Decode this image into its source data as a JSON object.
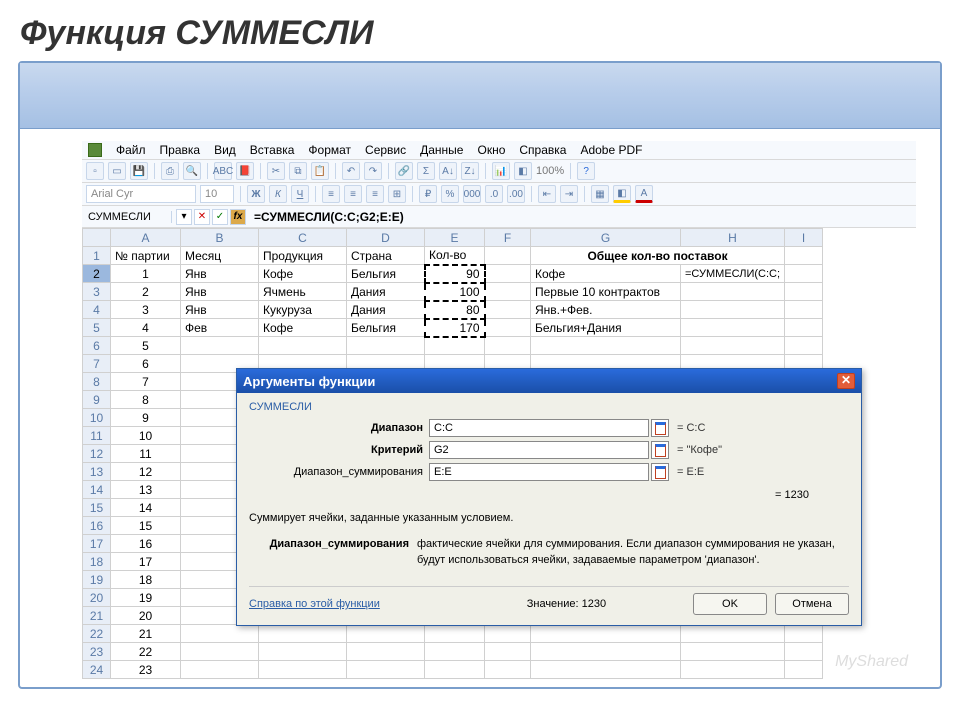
{
  "slide": {
    "title": "Функция СУММЕСЛИ"
  },
  "menu": {
    "items": [
      "Файл",
      "Правка",
      "Вид",
      "Вставка",
      "Формат",
      "Сервис",
      "Данные",
      "Окно",
      "Справка",
      "Adobe PDF"
    ]
  },
  "font": {
    "name": "Arial Cyr",
    "size": "10"
  },
  "toolbar": {
    "zoom": "100%",
    "bold": "Ж",
    "italic": "К",
    "underline": "Ч",
    "sum": "Σ",
    "abc": "ABC"
  },
  "formula_bar": {
    "name_box": "СУММЕСЛИ",
    "formula": "=СУММЕСЛИ(C:C;G2;E:E)"
  },
  "columns": [
    "A",
    "B",
    "C",
    "D",
    "E",
    "F",
    "G",
    "H",
    "I"
  ],
  "headers": {
    "a": "№ партии",
    "b": "Месяц",
    "c": "Продукция",
    "d": "Страна",
    "e": "Кол-во",
    "gh": "Общее кол-во поставок"
  },
  "rows": [
    {
      "n": "1",
      "a": "1",
      "b": "Янв",
      "c": "Кофе",
      "d": "Бельгия",
      "e": "90",
      "g": "Кофе",
      "h": "=СУММЕСЛИ(C:C;"
    },
    {
      "n": "2",
      "a": "2",
      "b": "Янв",
      "c": "Ячмень",
      "d": "Дания",
      "e": "100",
      "g": "Первые 10 контрактов",
      "h": ""
    },
    {
      "n": "3",
      "a": "3",
      "b": "Янв",
      "c": "Кукуруза",
      "d": "Дания",
      "e": "80",
      "g": "Янв.+Фев.",
      "h": ""
    },
    {
      "n": "4",
      "a": "4",
      "b": "Фев",
      "c": "Кофе",
      "d": "Бельгия",
      "e": "170",
      "g": "Бельгия+Дания",
      "h": ""
    }
  ],
  "row_numbers_tail": [
    "6",
    "7",
    "8",
    "9",
    "10",
    "11",
    "12",
    "13",
    "14",
    "15",
    "16",
    "17",
    "18",
    "19",
    "20",
    "21",
    "22",
    "23",
    "24"
  ],
  "a_tail": [
    "5",
    "6",
    "7",
    "8",
    "9",
    "10",
    "11",
    "12",
    "13",
    "14",
    "15",
    "16",
    "17",
    "18",
    "19",
    "20",
    "21",
    "22",
    "23"
  ],
  "dialog": {
    "title": "Аргументы функции",
    "func": "СУММЕСЛИ",
    "args": [
      {
        "label": "Диапазон",
        "bold": true,
        "value": "C:C",
        "eq": "= C:C"
      },
      {
        "label": "Критерий",
        "bold": true,
        "value": "G2",
        "eq": "= \"Кофе\""
      },
      {
        "label": "Диапазон_суммирования",
        "bold": false,
        "value": "E:E",
        "eq": "= E:E"
      }
    ],
    "result": "= 1230",
    "desc": "Суммирует ячейки, заданные указанным условием.",
    "param_name": "Диапазон_суммирования",
    "param_desc": "фактические ячейки для суммирования. Если диапазон суммирования не указан, будут использоваться ячейки, задаваемые параметром 'диапазон'.",
    "help": "Справка по этой функции",
    "value_label": "Значение:",
    "value": "1230",
    "ok": "OK",
    "cancel": "Отмена"
  },
  "watermark": "MyShared"
}
